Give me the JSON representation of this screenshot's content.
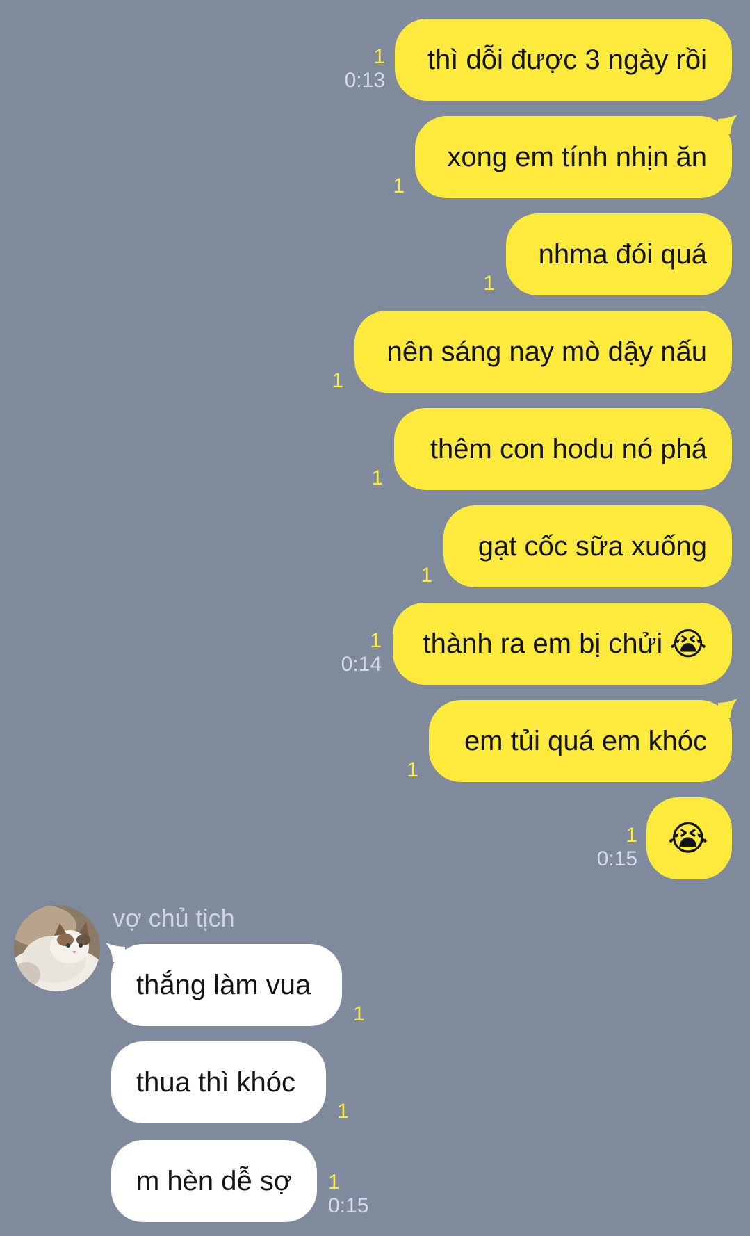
{
  "conversation": {
    "outgoing": [
      {
        "text": "thì dỗi được 3 ngày rồi",
        "read_count": "1",
        "time": "0:13"
      },
      {
        "text": "xong em tính nhịn ăn",
        "read_count": "1"
      },
      {
        "text": "nhma đói quá",
        "read_count": "1"
      },
      {
        "text": "nên sáng nay mò dậy nấu",
        "read_count": "1"
      },
      {
        "text": "thêm con hodu nó phá",
        "read_count": "1"
      },
      {
        "text": "gạt cốc sữa xuống",
        "read_count": "1"
      },
      {
        "text": "thành ra em bị chửi",
        "emoji": "😭",
        "read_count": "1",
        "time": "0:14"
      },
      {
        "text": "em tủi quá em khóc",
        "read_count": "1"
      },
      {
        "text": "",
        "emoji": "😭",
        "read_count": "1",
        "time": "0:15"
      }
    ],
    "incoming": {
      "sender_name": "vợ chủ tịch",
      "messages": [
        {
          "text": "thắng làm vua",
          "read_count": "1"
        },
        {
          "text": "thua thì khóc",
          "read_count": "1"
        },
        {
          "text": "m hèn dễ sợ",
          "read_count": "1",
          "time": "0:15"
        }
      ]
    }
  },
  "colors": {
    "background": "#7f8b9c",
    "outgoing_bubble": "#fdea3d",
    "incoming_bubble": "#ffffff",
    "read_count": "#fdea3d",
    "timestamp": "#d6dbe2"
  },
  "icons": {
    "avatar": "cat-avatar-icon"
  }
}
